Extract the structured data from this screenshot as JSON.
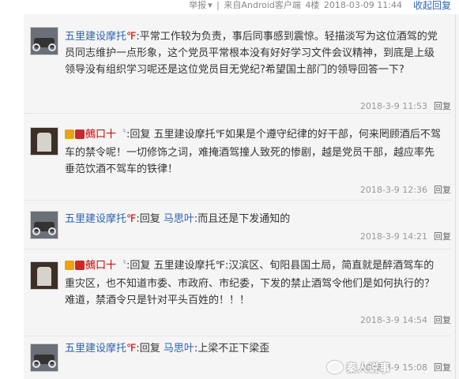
{
  "topbar": {
    "report": "举报",
    "report_arrow": "▾",
    "divider": "|",
    "source": "来自Android客户端",
    "floor": "4楼",
    "datetime": "2018-03-09 11:44",
    "fold": "收起回复"
  },
  "replies": [
    {
      "avatar": "motorbike-avatar",
      "user": "五里建设摩托",
      "user_suffix": "℉",
      "prefix": ":",
      "target": "",
      "body": "平常工作较为负责，事后同事感到震惊。轻描淡写为这位酒驾的党员同志维护一点形象，这个党员平常根本没有好好学习文件会议精神，到底是上级领导没有组织学习呢还是这位党员目无党纪?希望国土部门的领导回答一下?",
      "time": "2018-3-9 11:53",
      "reply_label": "回复"
    },
    {
      "avatar": "gun-avatar",
      "user": "鵺口十",
      "user_suffix": "〝",
      "prefix": ":回复 ",
      "target": "五里建设摩托℉",
      "body": "如果是个遵守纪律的好干部，何来罔顾酒后不驾车的禁令呢！一切修饰之词，难掩酒驾撞人致死的惨剧，越是党员干部，越应率先垂范饮酒不驾车的铁律！",
      "time": "2018-3-9 12:36",
      "reply_label": "回复"
    },
    {
      "avatar": "motorbike-avatar",
      "user": "五里建设摩托",
      "user_suffix": "℉",
      "prefix": ":回复 ",
      "target": "马思叶",
      "body": ":而且还是下发通知的",
      "time": "2018-3-9 14:21",
      "reply_label": "回复"
    },
    {
      "avatar": "gun-avatar",
      "user": "鵺口十",
      "user_suffix": "〝",
      "prefix": ":回复 ",
      "target": "五里建设摩托℉",
      "body": ":汉滨区、旬阳县国土局，简直就是醉酒驾车的重灾区，也不知道市委、市政府、市纪委，下发的禁止酒驾令他们是如何执行的？难道，禁酒令只是针对平头百姓的！！！",
      "time": "2018-3-9 14:54",
      "reply_label": "回复"
    },
    {
      "avatar": "motorbike-avatar",
      "user": "五里建设摩托",
      "user_suffix": "℉",
      "prefix": ":回复 ",
      "target": "马思叶",
      "body": ":上梁不正下梁歪",
      "time": "2018-3-9 15:08",
      "reply_label": "回复"
    }
  ],
  "watermark": "秦人说事"
}
